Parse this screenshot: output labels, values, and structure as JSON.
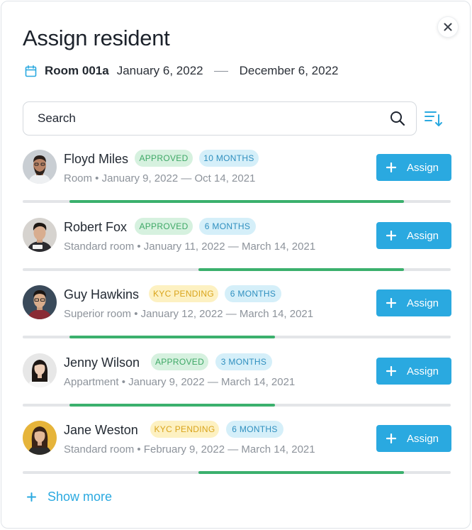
{
  "dialog": {
    "title": "Assign resident",
    "close_icon": "close-icon",
    "room": "Room 001a",
    "start_date": "January 6, 2022",
    "end_date": "December 6, 2022"
  },
  "search": {
    "placeholder": "Search",
    "value": ""
  },
  "colors": {
    "accent": "#2aa9e0",
    "progress": "#3bb06d",
    "approved": "#3ea866",
    "kyc_pending": "#d9a41c",
    "months": "#2f8fbf"
  },
  "residents": [
    {
      "name": "Floyd Miles",
      "status": "APPROVED",
      "duration": "10 MONTHS",
      "details": "Room • January 9, 2022 — Oct 14, 2021",
      "assign_label": "Assign",
      "progress_start": 0.11,
      "progress_end": 0.89
    },
    {
      "name": "Robert Fox",
      "status": "APPROVED",
      "duration": "6 MONTHS",
      "details": "Standard room • January 11, 2022 — March 14, 2021",
      "assign_label": "Assign",
      "progress_start": 0.41,
      "progress_end": 0.89
    },
    {
      "name": "Guy Hawkins",
      "status": "KYC PENDING",
      "duration": "6 MONTHS",
      "details": "Superior room • January 12, 2022 — March 14, 2021",
      "assign_label": "Assign",
      "progress_start": 0.11,
      "progress_end": 0.59
    },
    {
      "name": "Jenny Wilson",
      "status": "APPROVED",
      "duration": "3 MONTHS",
      "details": "Appartment • January 9, 2022 — March 14, 2021",
      "assign_label": "Assign",
      "progress_start": 0.11,
      "progress_end": 0.59
    },
    {
      "name": "Jane Weston",
      "status": "KYC PENDING",
      "duration": "6 MONTHS",
      "details": "Standard room • February 9, 2022 — March 14, 2021",
      "assign_label": "Assign",
      "progress_start": 0.41,
      "progress_end": 0.89
    }
  ],
  "show_more_label": "Show more"
}
